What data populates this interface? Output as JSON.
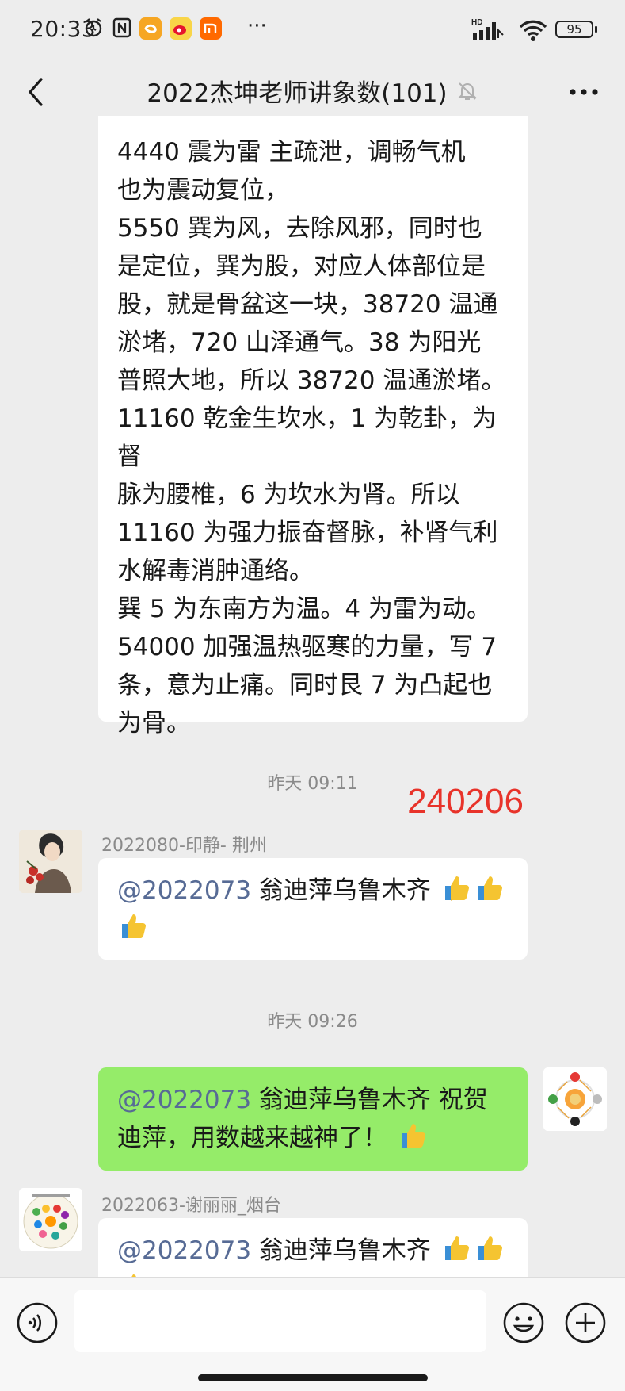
{
  "status_bar": {
    "time": "20:33",
    "battery": "95",
    "network": "HD",
    "icons": [
      "alarm-icon",
      "nfc-icon",
      "taobao-icon",
      "weibo-icon",
      "mi-icon",
      "more-dots-icon",
      "signal-icon",
      "wifi-icon",
      "battery-icon"
    ]
  },
  "header": {
    "title": "2022杰坤老师讲象数(101)",
    "icons": [
      "back-icon",
      "mute-bell-icon",
      "more-icon"
    ]
  },
  "messages": {
    "first": {
      "lines": [
        "4440 震为雷  主疏泄，调畅气机",
        "也为震动复位，",
        "5550 巽为风，去除风邪，同时也",
        "是定位，巽为股，对应人体部位是",
        "股，就是骨盆这一块，38720 温通",
        "淤堵，720 山泽通气。38 为阳光",
        "普照大地，所以 38720 温通淤堵。",
        "11160 乾金生坎水，1 为乾卦，为督",
        "脉为腰椎，6 为坎水为肾。所以",
        "11160 为强力振奋督脉，补肾气利",
        "水解毒消肿通络。",
        "巽 5 为东南方为温。4 为雷为动。",
        "54000 加强温热驱寒的力量，写 7",
        "条，意为止痛。同时艮 7 为凸起也",
        "为骨。"
      ]
    },
    "ts1": "昨天 09:11",
    "annotation": "240206",
    "second": {
      "sender": "2022080-印静- 荆州",
      "mention": "@2022073",
      "text": " 翁迪萍乌鲁木齐 "
    },
    "ts2": "昨天 09:26",
    "third": {
      "mention": "@2022073",
      "line1": " 翁迪萍乌鲁木齐  祝贺",
      "line2": "迪萍，用数越来越神了！"
    },
    "fourth": {
      "sender": "2022063-谢丽丽_烟台",
      "mention": "@2022073",
      "text": " 翁迪萍乌鲁木齐 "
    }
  },
  "input": {
    "placeholder": "",
    "icons": [
      "voice-icon",
      "emoji-icon",
      "plus-icon"
    ]
  }
}
